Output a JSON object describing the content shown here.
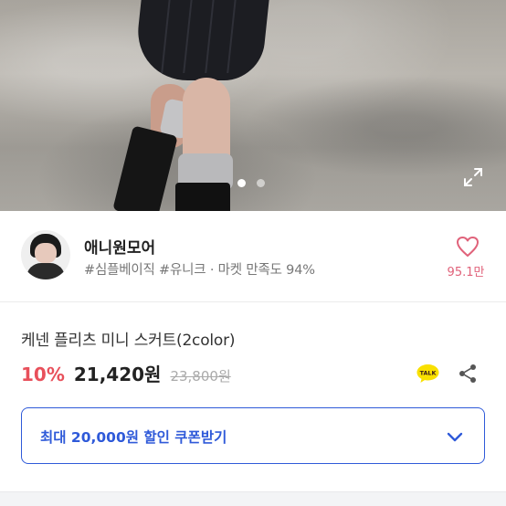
{
  "gallery": {
    "slide_count": 2,
    "active_slide": 1,
    "expand_icon": "expand-icon"
  },
  "seller": {
    "name": "애니원모어",
    "tags": "#심플베이직 #유니크 · 마켓 만족도 94%",
    "like_count": "95.1만",
    "like_icon": "heart-icon"
  },
  "product": {
    "title": "케넨 플리츠 미니 스커트(2color)",
    "discount": "10%",
    "price": "21,420원",
    "original_price": "23,800원",
    "talk_label": "TALK",
    "share_icon": "share-icon"
  },
  "coupon": {
    "label": "최대 20,000원 할인 쿠폰받기",
    "icon": "chevron-down-icon"
  },
  "colors": {
    "accent": "#2f5ad9",
    "discount": "#e8505b",
    "like": "#e0627a",
    "kakao": "#3a1d1d"
  }
}
